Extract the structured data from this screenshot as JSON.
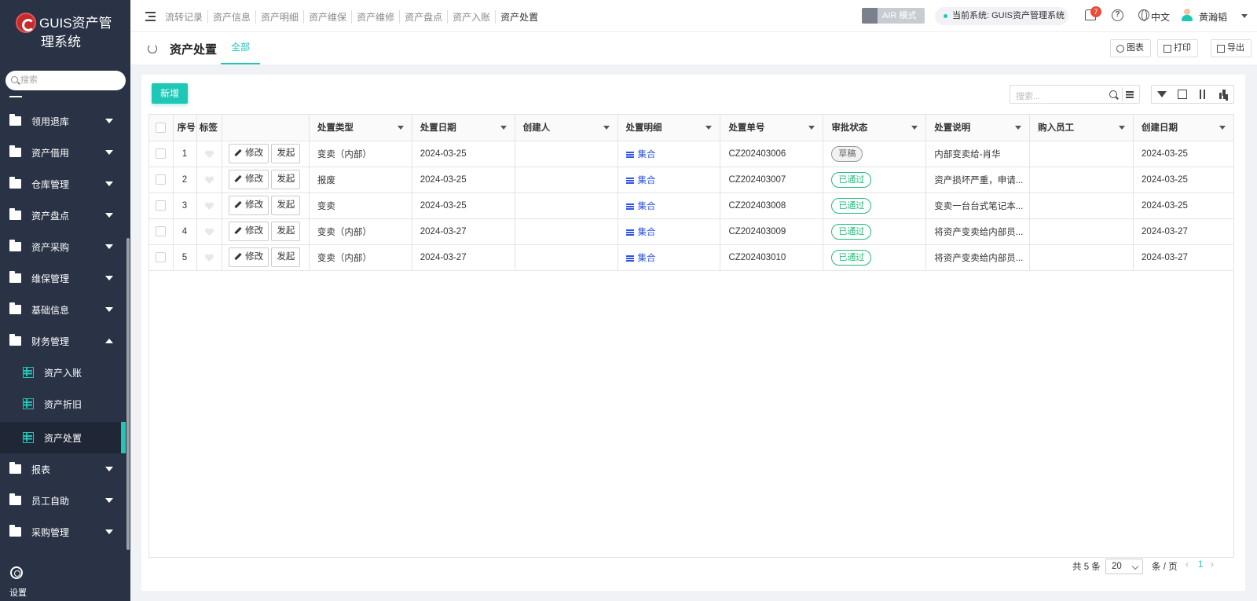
{
  "app": {
    "logo_line1": "GUIS资产管",
    "logo_line2": "理系统"
  },
  "sidebar": {
    "search_placeholder": "搜索",
    "items": [
      {
        "label": "领用退库",
        "expanded": false
      },
      {
        "label": "资产借用",
        "expanded": false
      },
      {
        "label": "仓库管理",
        "expanded": false
      },
      {
        "label": "资产盘点",
        "expanded": false
      },
      {
        "label": "资产采购",
        "expanded": false
      },
      {
        "label": "维保管理",
        "expanded": false
      },
      {
        "label": "基础信息",
        "expanded": false
      },
      {
        "label": "财务管理",
        "expanded": true
      }
    ],
    "sub_items": [
      {
        "label": "资产入账"
      },
      {
        "label": "资产折旧"
      },
      {
        "label": "资产处置",
        "active": true
      }
    ],
    "items_after": [
      {
        "label": "报表"
      },
      {
        "label": "员工自助"
      },
      {
        "label": "采购管理"
      }
    ],
    "settings_label": "设置"
  },
  "topbar": {
    "breadcrumbs": [
      "流转记录",
      "资产信息",
      "资产明细",
      "资产维保",
      "资产维修",
      "资产盘点",
      "资产入账",
      "资产处置"
    ],
    "air_mode": "AIR 模式",
    "current_system": "当前系统: GUIS资产管理系统",
    "notification_count": "7",
    "help": "?",
    "language": "中文",
    "user_name": "黄瀚韬"
  },
  "page": {
    "title": "资产处置",
    "tab_all": "全部",
    "chart_btn": "图表",
    "print_btn": "打印",
    "export_btn": "导出"
  },
  "toolbar": {
    "add_btn": "新增",
    "search_placeholder": "搜索..."
  },
  "table": {
    "headers": {
      "seq": "序号",
      "tag": "标签",
      "type": "处置类型",
      "date": "处置日期",
      "creator": "创建人",
      "detail": "处置明细",
      "number": "处置单号",
      "status": "审批状态",
      "desc": "处置说明",
      "buyer": "购入员工",
      "created": "创建日期"
    },
    "edit_label": "修改",
    "submit_label": "发起",
    "detail_link": "集合",
    "rows": [
      {
        "seq": "1",
        "type": "变卖（内部）",
        "date": "2024-03-25",
        "creator": "",
        "number": "CZ202403006",
        "status": "草稿",
        "status_kind": "draft",
        "desc": "内部变卖给-肖华",
        "buyer": "",
        "created": "2024-03-25"
      },
      {
        "seq": "2",
        "type": "报废",
        "date": "2024-03-25",
        "creator": "",
        "number": "CZ202403007",
        "status": "已通过",
        "status_kind": "pass",
        "desc": "资产损坏严重，申请...",
        "buyer": "",
        "created": "2024-03-25"
      },
      {
        "seq": "3",
        "type": "变卖",
        "date": "2024-03-25",
        "creator": "",
        "number": "CZ202403008",
        "status": "已通过",
        "status_kind": "pass",
        "desc": "变卖一台台式笔记本...",
        "buyer": "",
        "created": "2024-03-25"
      },
      {
        "seq": "4",
        "type": "变卖（内部）",
        "date": "2024-03-27",
        "creator": "",
        "number": "CZ202403009",
        "status": "已通过",
        "status_kind": "pass",
        "desc": "将资产变卖给内部员...",
        "buyer": "",
        "created": "2024-03-27"
      },
      {
        "seq": "5",
        "type": "变卖（内部）",
        "date": "2024-03-27",
        "creator": "",
        "number": "CZ202403010",
        "status": "已通过",
        "status_kind": "pass",
        "desc": "将资产变卖给内部员...",
        "buyer": "",
        "created": "2024-03-27"
      }
    ]
  },
  "pagination": {
    "total": "共 5 条",
    "page_size": "20",
    "per_page": "条 / 页",
    "prev": "‹",
    "current": "1",
    "next": "›"
  },
  "colors": {
    "accent": "#1ec7b6",
    "sidebar_bg": "#2a3346",
    "pass": "#1fbd7b"
  }
}
